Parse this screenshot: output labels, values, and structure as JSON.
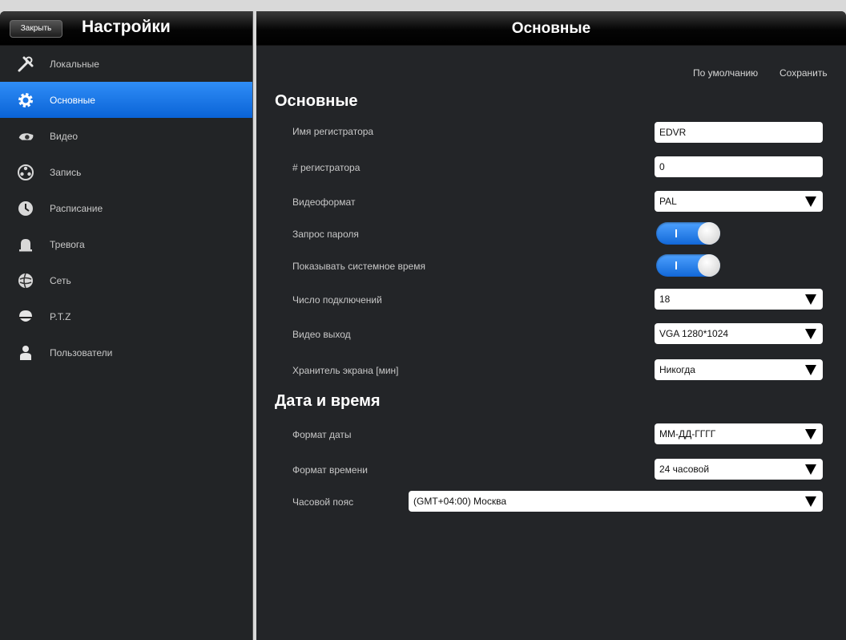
{
  "sidebar": {
    "close_label": "Закрыть",
    "title": "Настройки",
    "items": [
      {
        "label": "Локальные",
        "icon": "tools-icon"
      },
      {
        "label": "Основные",
        "icon": "gear-icon",
        "active": true
      },
      {
        "label": "Видео",
        "icon": "camera-icon"
      },
      {
        "label": "Запись",
        "icon": "film-reel-icon"
      },
      {
        "label": "Расписание",
        "icon": "clock-icon"
      },
      {
        "label": "Тревога",
        "icon": "alarm-bell-icon"
      },
      {
        "label": "Сеть",
        "icon": "globe-icon"
      },
      {
        "label": "P.T.Z",
        "icon": "ptz-camera-icon"
      },
      {
        "label": "Пользователи",
        "icon": "user-icon"
      }
    ]
  },
  "main": {
    "header_title": "Основные",
    "actions": {
      "defaults": "По умолчанию",
      "save": "Сохранить"
    },
    "sections": {
      "general": {
        "title": "Основные",
        "recorder_name": {
          "label": "Имя регистратора",
          "value": "EDVR"
        },
        "recorder_number": {
          "label": "# регистратора",
          "value": "0"
        },
        "video_format": {
          "label": "Видеоформат",
          "value": "PAL"
        },
        "password_request": {
          "label": "Запрос пароля",
          "enabled": true
        },
        "show_system_time": {
          "label": "Показывать системное время",
          "enabled": true
        },
        "connections": {
          "label": "Число подключений",
          "value": "18"
        },
        "video_output": {
          "label": "Видео выход",
          "value": "VGA 1280*1024"
        },
        "screensaver": {
          "label": "Хранитель экрана [мин]",
          "value": "Никогда"
        }
      },
      "datetime": {
        "title": "Дата и время",
        "date_format": {
          "label": "Формат даты",
          "value": "ММ-ДД-ГГГГ"
        },
        "time_format": {
          "label": "Формат времени",
          "value": "24 часовой"
        },
        "timezone": {
          "label": "Часовой пояс",
          "value": "(GMT+04:00) Москва"
        }
      }
    }
  },
  "colors": {
    "accent": "#1a76ea",
    "toggle_on": "#2a86f0",
    "panel_bg": "#232528"
  }
}
